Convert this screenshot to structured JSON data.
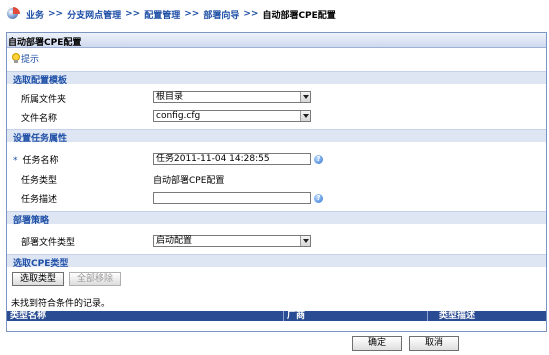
{
  "breadcrumb": {
    "items": [
      "业务",
      "分支网点管理",
      "配置管理",
      "部署向导"
    ],
    "separator": ">>",
    "current": "自动部署CPE配置"
  },
  "panel": {
    "title": "自动部署CPE配置",
    "hint": "提示"
  },
  "sections": {
    "template": "选取配置模板",
    "task_attr": "设置任务属性",
    "strategy": "部署策略",
    "cpe_type": "选取CPE类型"
  },
  "form": {
    "folder_label": "所属文件夹",
    "folder_value": "根目录",
    "file_label": "文件名称",
    "file_value": "config.cfg",
    "required_mark": "*",
    "task_name_label": "任务名称",
    "task_name_value": "任务2011-11-04 14:28:55",
    "task_type_label": "任务类型",
    "task_type_value": "自动部署CPE配置",
    "task_desc_label": "任务描述",
    "task_desc_value": "",
    "deploy_file_type_label": "部署文件类型",
    "deploy_file_type_value": "启动配置",
    "help_glyph": "?"
  },
  "cpe": {
    "select_type_button": "选取类型",
    "remove_all_button": "全部移除",
    "no_match_text": "未找到符合条件的记录。",
    "columns": [
      "类型名称",
      "厂商",
      "类型描述"
    ]
  },
  "footer": {
    "ok": "确定",
    "cancel": "取消"
  },
  "colors": {
    "link": "#1e4fa6",
    "section_bg": "#dee6f4",
    "table_header_bg": "#2a4c93",
    "panel_border": "#7d95c2"
  }
}
